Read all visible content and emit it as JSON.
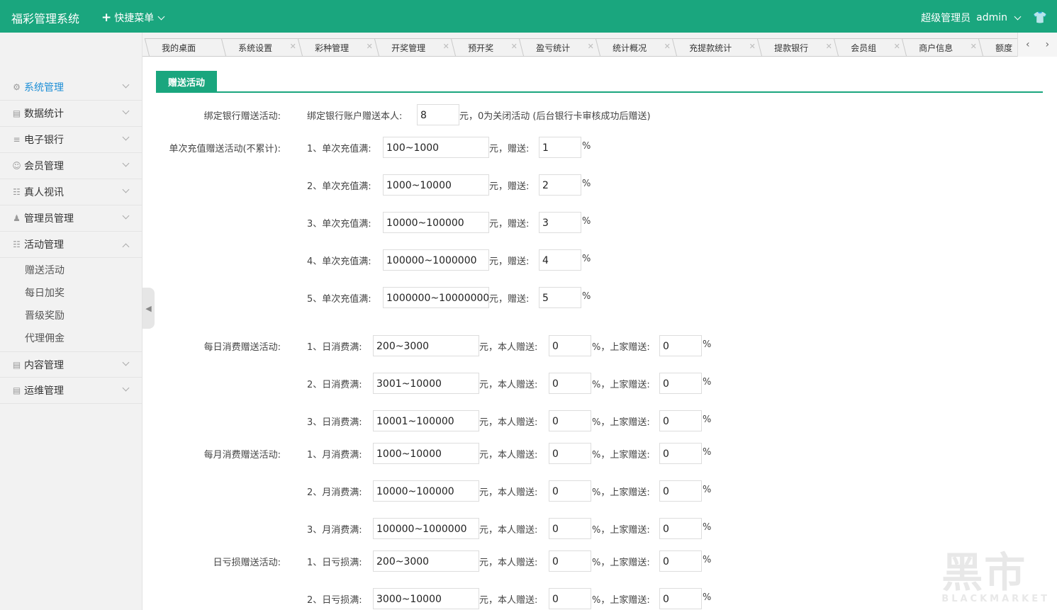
{
  "header": {
    "brand": "福彩管理系统",
    "quick_menu": "快捷菜单",
    "role": "超级管理员",
    "username": "admin",
    "shirt_icon": "shirt-icon",
    "color": "#1aa67e"
  },
  "tabs": [
    "我的桌面",
    "系统设置",
    "彩种管理",
    "开奖管理",
    "预开奖",
    "盈亏统计",
    "统计概况",
    "充提款统计",
    "提款银行",
    "会员组",
    "商户信息",
    "额度"
  ],
  "sidebar": {
    "items": [
      {
        "label": "系统管理",
        "icon": "gear-icon"
      },
      {
        "label": "数据统计",
        "icon": "chart-icon"
      },
      {
        "label": "电子银行",
        "icon": "list-icon"
      },
      {
        "label": "会员管理",
        "icon": "user-icon"
      },
      {
        "label": "真人视讯",
        "icon": "gift-icon"
      },
      {
        "label": "管理员管理",
        "icon": "person-icon"
      },
      {
        "label": "活动管理",
        "icon": "gift-icon"
      },
      {
        "label": "内容管理",
        "icon": "doc-icon"
      },
      {
        "label": "运维管理",
        "icon": "doc-icon"
      }
    ],
    "sub_items": [
      "赠送活动",
      "每日加奖",
      "晋级奖励",
      "代理佣金"
    ]
  },
  "page": {
    "title": "赠送活动"
  },
  "bind_bank": {
    "label": "绑定银行赠送活动:",
    "prefix": "绑定银行账户赠送本人:",
    "value": "8",
    "suffix": "元，0为关闭活动 (后台银行卡审核成功后赠送)"
  },
  "recharge": {
    "label": "单次充值赠送活动(不累计):",
    "unit_text": "元，赠送:",
    "percent": "%",
    "rows": [
      {
        "prefix": "1、单次充值满:",
        "range": "100~1000",
        "rate": "1"
      },
      {
        "prefix": "2、单次充值满:",
        "range": "1000~10000",
        "rate": "2"
      },
      {
        "prefix": "3、单次充值满:",
        "range": "10000~100000",
        "rate": "3"
      },
      {
        "prefix": "4、单次充值满:",
        "range": "100000~1000000",
        "rate": "4"
      },
      {
        "prefix": "5、单次充值满:",
        "range": "1000000~10000000",
        "rate": "5"
      }
    ]
  },
  "consume_text": {
    "self": "元，本人赠送:",
    "parent": "%，上家赠送:",
    "percent": "%"
  },
  "daily": {
    "label": "每日消费赠送活动:",
    "rows": [
      {
        "prefix": "1、日消费满:",
        "range": "200~3000",
        "self": "0",
        "parent": "0"
      },
      {
        "prefix": "2、日消费满:",
        "range": "3001~10000",
        "self": "0",
        "parent": "0"
      },
      {
        "prefix": "3、日消费满:",
        "range": "10001~100000",
        "self": "0",
        "parent": "0"
      }
    ]
  },
  "monthly": {
    "label": "每月消费赠送活动:",
    "rows": [
      {
        "prefix": "1、月消费满:",
        "range": "1000~10000",
        "self": "0",
        "parent": "0"
      },
      {
        "prefix": "2、月消费满:",
        "range": "10000~100000",
        "self": "0",
        "parent": "0"
      },
      {
        "prefix": "3、月消费满:",
        "range": "100000~1000000",
        "self": "0",
        "parent": "0"
      }
    ]
  },
  "loss": {
    "label": "日亏损赠送活动:",
    "rows": [
      {
        "prefix": "1、日亏损满:",
        "range": "200~3000",
        "self": "0",
        "parent": "0"
      },
      {
        "prefix": "2、日亏损满:",
        "range": "3000~10000",
        "self": "0",
        "parent": "0"
      }
    ]
  },
  "watermark": {
    "big": "黑市",
    "small": "BLACKMARKET"
  }
}
